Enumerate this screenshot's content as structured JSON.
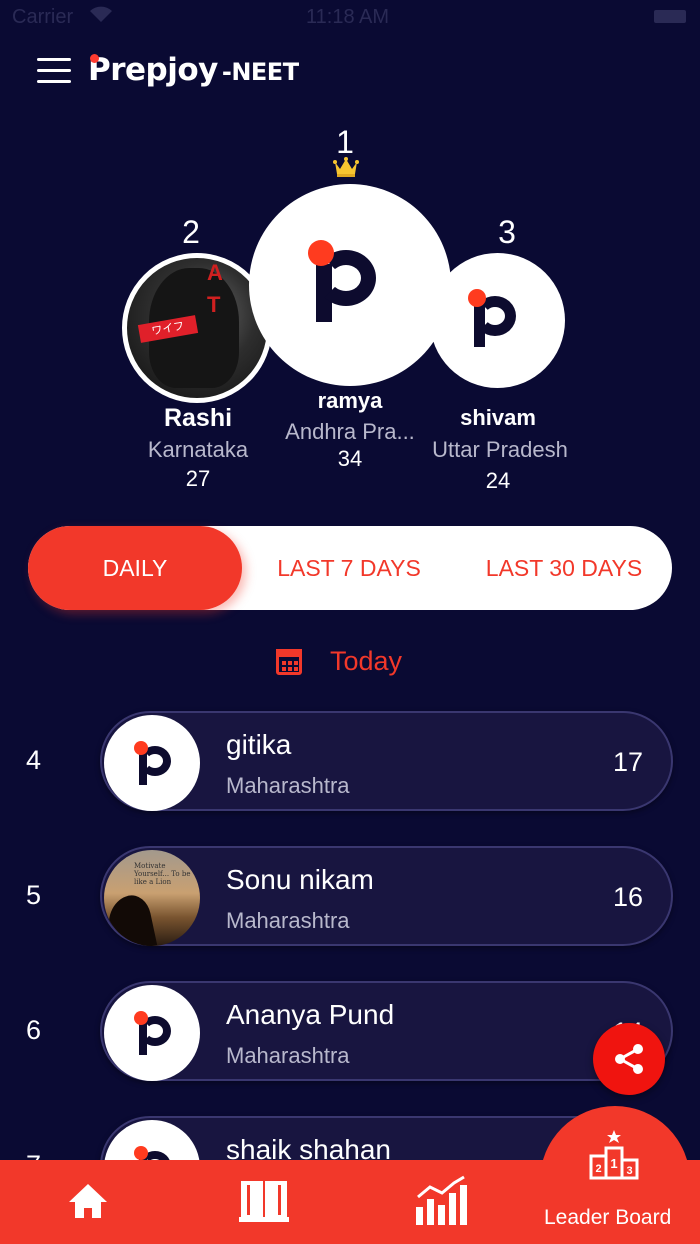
{
  "status_bar": {
    "carrier": "Carrier",
    "time": "11:18 AM"
  },
  "header": {
    "brand": "Prepjoy",
    "brand_suffix": "-NEET"
  },
  "podium": [
    {
      "rank": "1",
      "name": "ramya",
      "state": "Andhra Pra...",
      "score": "34"
    },
    {
      "rank": "2",
      "name": "Rashi",
      "state": "Karnataka",
      "score": "27"
    },
    {
      "rank": "3",
      "name": "shivam",
      "state": "Uttar Pradesh",
      "score": "24"
    }
  ],
  "tabs": [
    {
      "label": "DAILY",
      "active": true
    },
    {
      "label": "LAST 7 DAYS",
      "active": false
    },
    {
      "label": "LAST 30 DAYS",
      "active": false
    }
  ],
  "date_filter": {
    "label": "Today"
  },
  "list": [
    {
      "rank": "4",
      "name": "gitika",
      "state": "Maharashtra",
      "score": "17"
    },
    {
      "rank": "5",
      "name": "Sonu nikam",
      "state": "Maharashtra",
      "score": "16"
    },
    {
      "rank": "6",
      "name": "Ananya Pund",
      "state": "Maharashtra",
      "score": "14"
    },
    {
      "rank": "7",
      "name": "shaik shahan",
      "state": "",
      "score": ""
    }
  ],
  "bottom_nav": {
    "items": [
      {
        "icon": "home-icon"
      },
      {
        "icon": "book-icon"
      },
      {
        "icon": "stats-chart-icon"
      },
      {
        "icon": "podium-icon",
        "label": "Leader Board"
      }
    ]
  },
  "colors": {
    "background": "#0a0a33",
    "accent": "#f2382a",
    "card": "#181540"
  }
}
